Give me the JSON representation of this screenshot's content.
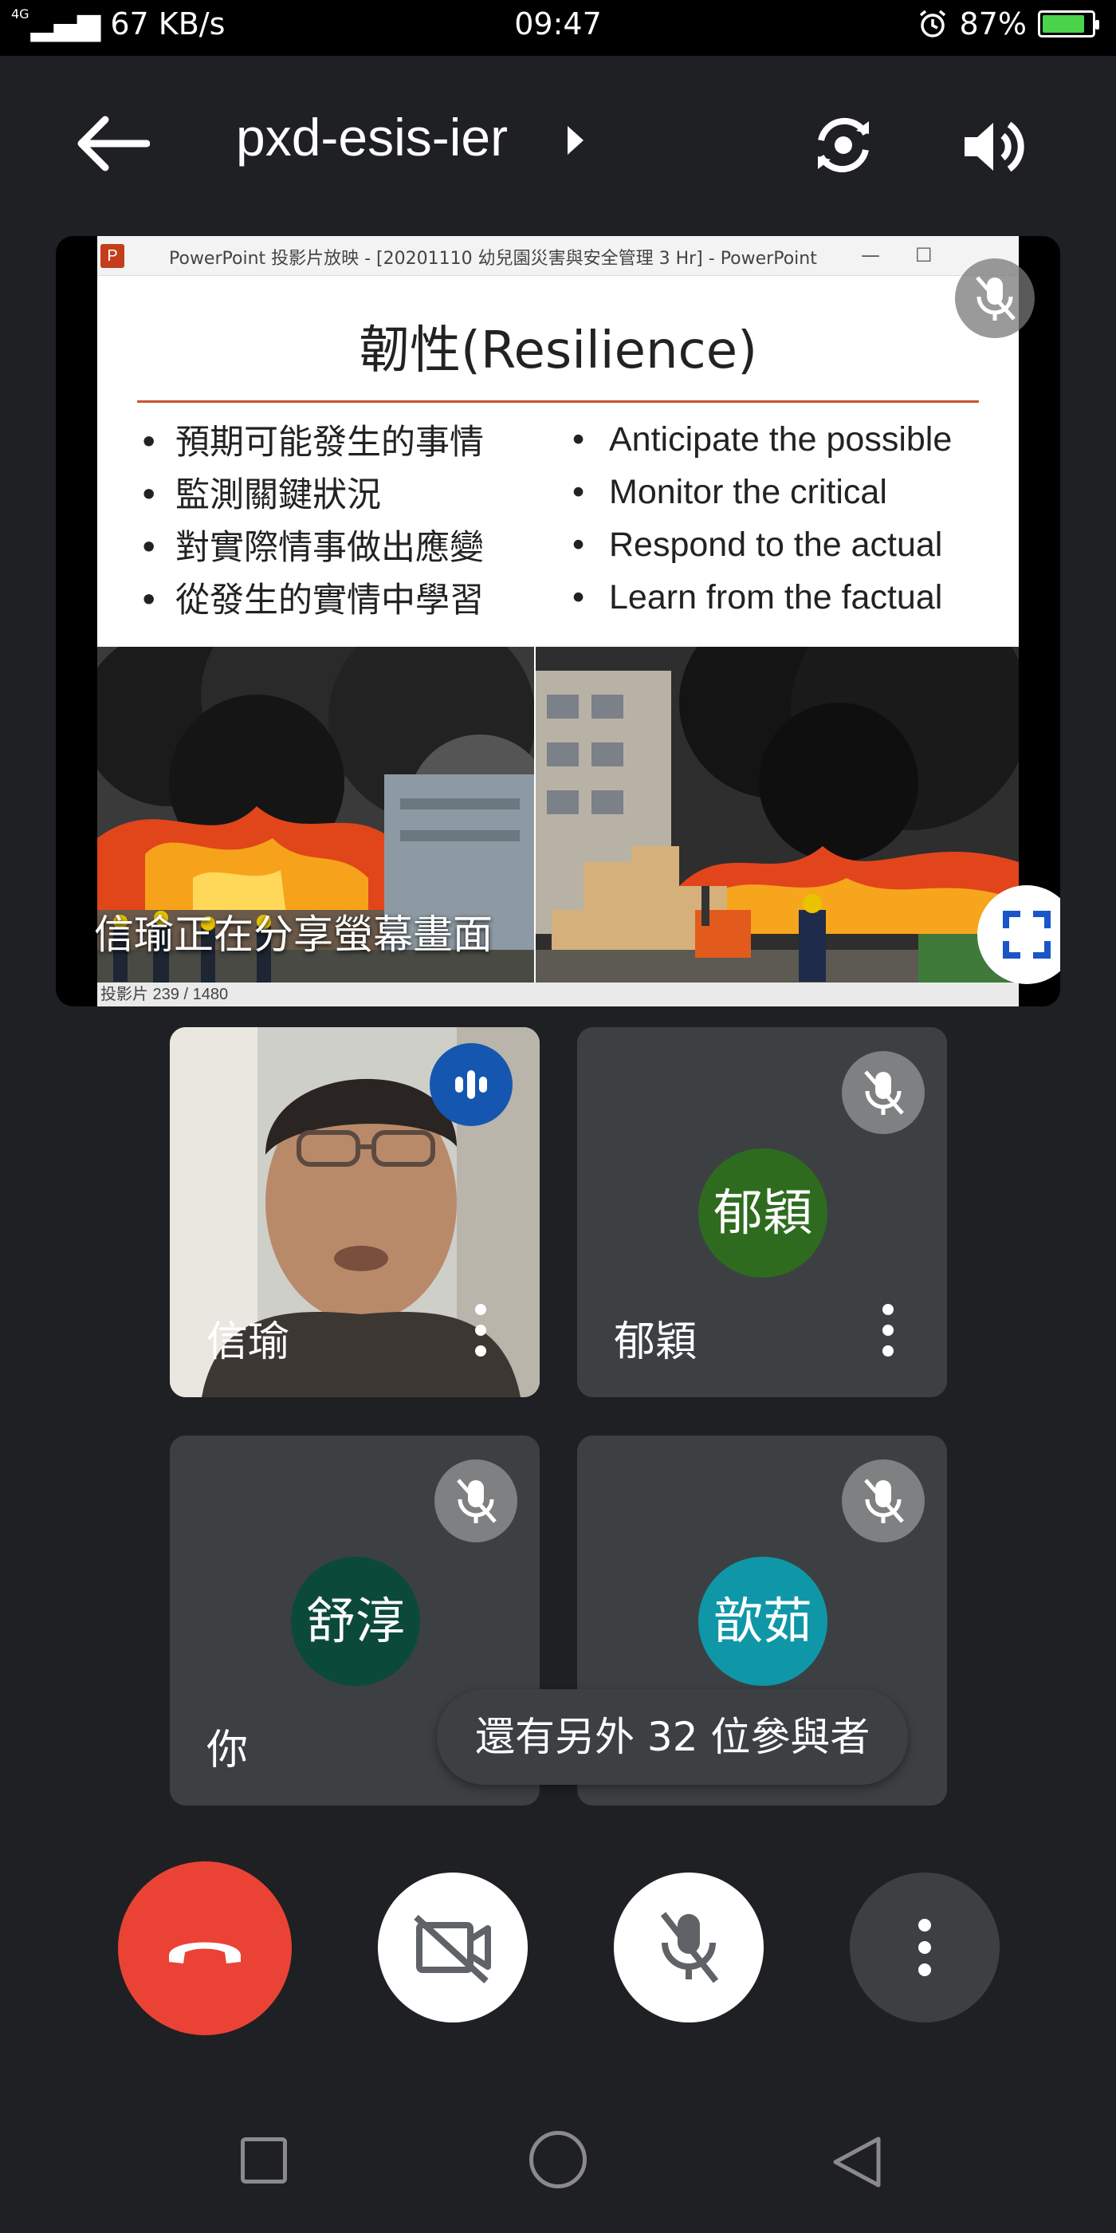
{
  "status_bar": {
    "network": "4G",
    "speed": "67 KB/s",
    "time": "09:47",
    "battery": "87%",
    "battery_level": 0.87,
    "icons": [
      "signal-icon",
      "alarm-icon",
      "battery-charging-icon"
    ]
  },
  "header": {
    "meeting_code": "pxd-esis-ier",
    "icons": [
      "back-arrow-icon",
      "chevron-right-icon",
      "switch-camera-icon",
      "speaker-icon"
    ]
  },
  "presentation": {
    "window_title": "PowerPoint 投影片放映 - [20201110 幼兒園災害與安全管理 3 Hr] - PowerPoint",
    "slide_title": "韌性(Resilience)",
    "bullets_zh": [
      "預期可能發生的事情",
      "監測關鍵狀況",
      "對實際情事做出應變",
      "從發生的實情中學習"
    ],
    "bullets_en": [
      "Anticipate the possible",
      "Monitor the critical",
      "Respond to the actual",
      "Learn from the factual"
    ],
    "slide_status": "投影片 239 / 1480",
    "sharing_caption": "信瑜正在分享螢幕畫面",
    "icons": [
      "mic-off-icon",
      "fullscreen-icon"
    ]
  },
  "participants": [
    {
      "name": "信瑜",
      "type": "video",
      "speaking": true
    },
    {
      "name": "郁穎",
      "avatar_text": "郁穎",
      "avatar_color": "#2e6b1f",
      "muted": true
    },
    {
      "name": "你",
      "avatar_text": "舒淳",
      "avatar_color": "#0b4a3a",
      "muted": true
    },
    {
      "name": "歆茹",
      "avatar_text": "歆茹",
      "avatar_color": "#0f97a8",
      "muted": true
    }
  ],
  "toast": "還有另外 32 位參與者",
  "controls": {
    "icons": [
      "end-call-icon",
      "camera-off-icon",
      "mic-off-icon",
      "more-options-icon"
    ],
    "end_call_color": "#ea4335"
  },
  "nav": {
    "icons": [
      "recents-icon",
      "home-icon",
      "back-icon"
    ]
  }
}
